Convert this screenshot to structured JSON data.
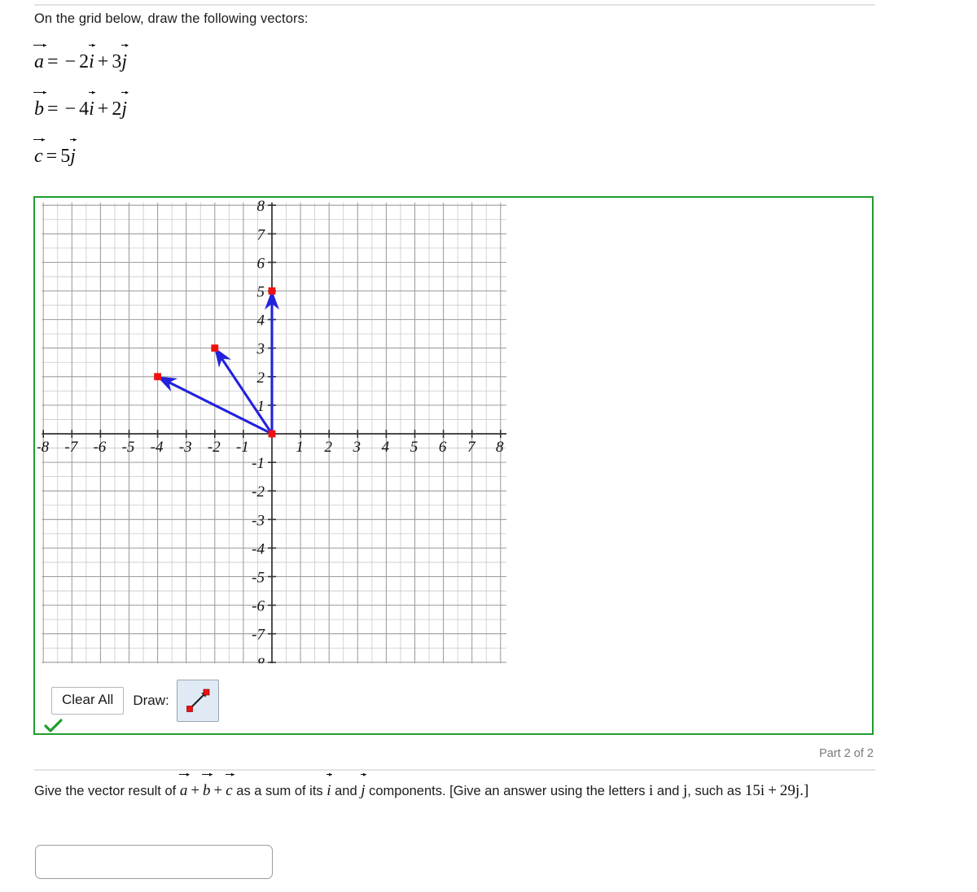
{
  "prompt": "On the grid below, draw the following vectors:",
  "equations": [
    {
      "name": "vector-a-equation",
      "lhs": "a",
      "rhs": [
        {
          "type": "op",
          "text": "="
        },
        {
          "type": "op",
          "text": "−"
        },
        {
          "type": "num",
          "text": "2"
        },
        {
          "type": "vec",
          "text": "i"
        },
        {
          "type": "op",
          "text": "+"
        },
        {
          "type": "num",
          "text": "3"
        },
        {
          "type": "vec",
          "text": "j"
        }
      ]
    },
    {
      "name": "vector-b-equation",
      "lhs": "b",
      "rhs": [
        {
          "type": "op",
          "text": "="
        },
        {
          "type": "op",
          "text": "−"
        },
        {
          "type": "num",
          "text": "4"
        },
        {
          "type": "vec",
          "text": "i"
        },
        {
          "type": "op",
          "text": "+"
        },
        {
          "type": "num",
          "text": "2"
        },
        {
          "type": "vec",
          "text": "j"
        }
      ]
    },
    {
      "name": "vector-c-equation",
      "lhs": "c",
      "rhs": [
        {
          "type": "op",
          "text": "="
        },
        {
          "type": "num",
          "text": "5"
        },
        {
          "type": "vec",
          "text": "j"
        }
      ]
    }
  ],
  "chart_data": {
    "type": "scatter",
    "title": "",
    "xlabel": "",
    "ylabel": "",
    "xlim": [
      -8,
      8
    ],
    "ylim": [
      -8,
      8
    ],
    "grid": true,
    "minor_grid_step": 0.5,
    "major_grid_step": 1,
    "xticks": [
      -8,
      -7,
      -6,
      -5,
      -4,
      -3,
      -2,
      -1,
      1,
      2,
      3,
      4,
      5,
      6,
      7,
      8
    ],
    "yticks": [
      8,
      7,
      6,
      5,
      4,
      3,
      2,
      1,
      -1,
      -2,
      -3,
      -4,
      -5,
      -6,
      -7,
      -8
    ],
    "xtick_labels": [
      "-8",
      "-7",
      "-6",
      "-5",
      "-4",
      "-3",
      "-2",
      "-1",
      "1",
      "2",
      "3",
      "4",
      "5",
      "6",
      "7",
      "8"
    ],
    "ytick_labels": [
      "8",
      "7",
      "6",
      "5",
      "4",
      "3",
      "2",
      "1",
      "-1",
      "-2",
      "-3",
      "-4",
      "-5",
      "-6",
      "-7",
      "-8"
    ],
    "legend": "none",
    "vectors": [
      {
        "name": "vector-a",
        "label": "a",
        "tail": [
          0,
          0
        ],
        "head": [
          -2,
          3
        ],
        "color": "#2222dd",
        "marker_color": "#ee1111"
      },
      {
        "name": "vector-b",
        "label": "b",
        "tail": [
          0,
          0
        ],
        "head": [
          -4,
          2
        ],
        "color": "#2222dd",
        "marker_color": "#ee1111"
      },
      {
        "name": "vector-c",
        "label": "c",
        "tail": [
          0,
          0
        ],
        "head": [
          0,
          5
        ],
        "color": "#2222dd",
        "marker_color": "#ee1111"
      }
    ],
    "points": [
      {
        "coords": [
          0,
          0
        ],
        "color": "#ee1111"
      },
      {
        "coords": [
          -2,
          3
        ],
        "color": "#ee1111"
      },
      {
        "coords": [
          -4,
          2
        ],
        "color": "#ee1111"
      },
      {
        "coords": [
          0,
          5
        ],
        "color": "#ee1111"
      }
    ]
  },
  "toolbar": {
    "clear_label": "Clear All",
    "draw_label": "Draw:",
    "tool_icon": "vector-arrow-icon",
    "tool_selected": true
  },
  "status": {
    "check_icon": "green-checkmark-icon",
    "check_color": "#1e9e2e"
  },
  "part_label": "Part 2 of 2",
  "question": {
    "seg1": "Give the vector result of ",
    "va": "a",
    "plus1": "+",
    "vb": "b",
    "plus2": "+",
    "vc": "c",
    "seg2": " as a sum of its ",
    "vi": "i",
    "seg3": " and ",
    "vj": "j",
    "seg4": " components. [Give an answer using the letters ",
    "li": "i",
    "seg5": " and ",
    "lj": "j",
    "seg6": ", such as ",
    "example_num1": "15",
    "example_i": "i",
    "example_plus": "+",
    "example_num2": "29",
    "example_j": "j",
    "seg7": ".]"
  },
  "answer_field": {
    "value": "",
    "placeholder": ""
  },
  "colors": {
    "vector": "#2222dd",
    "marker": "#ee1111",
    "container_border": "#1e9e2e",
    "grid_minor": "#c9c9c9",
    "grid_major": "#8a8a8a",
    "axis": "#303030"
  }
}
